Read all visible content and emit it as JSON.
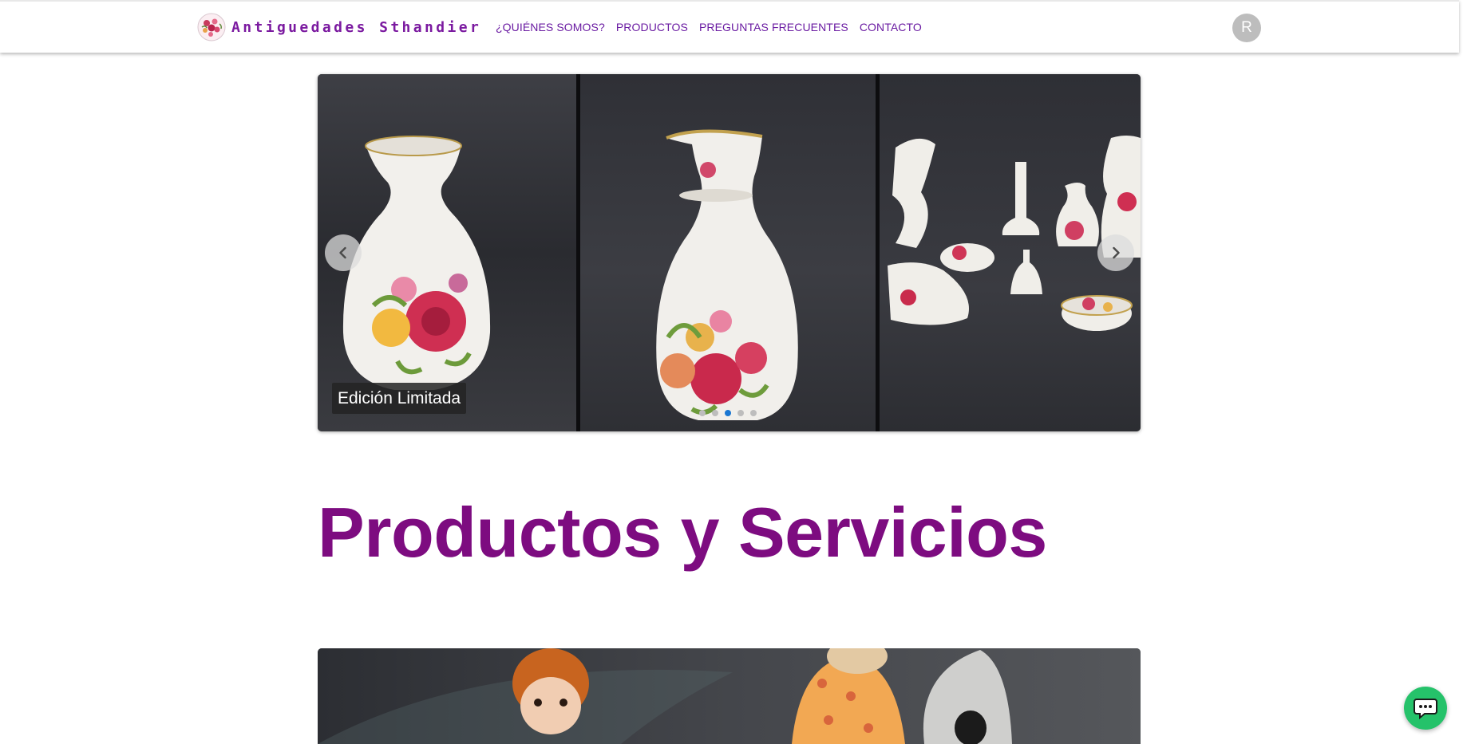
{
  "brand": {
    "name": "Antiguedades Sthandier",
    "logo_icon": "floral-logo-icon"
  },
  "nav": {
    "links": [
      "¿QUIÉNES SOMOS?",
      "PRODUCTOS",
      "PREGUNTAS FRECUENTES",
      "CONTACTO"
    ],
    "link_color": "#6a1ba2"
  },
  "user": {
    "avatar_initial": "R"
  },
  "carousel": {
    "caption": "Edición Limitada",
    "slides_count": 5,
    "active_slide": 3,
    "prev_icon": "chevron-left-icon",
    "next_icon": "chevron-right-icon"
  },
  "section": {
    "title": "Productos y Servicios",
    "title_color": "#7d0c80"
  },
  "chat": {
    "icon": "chat-bubble-icon",
    "color": "#25c26a"
  }
}
